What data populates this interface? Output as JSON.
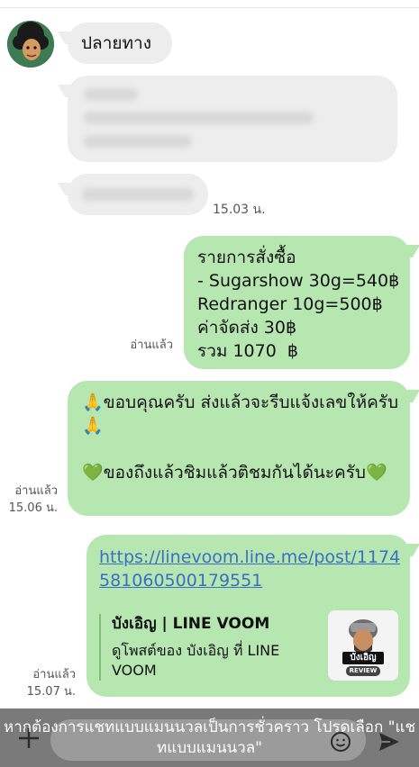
{
  "chat": {
    "sender_name": "ปลายทาง",
    "time_1": "15.03 น.",
    "order": {
      "lines": "รายการสั่งซื้อ\n- Sugarshow 30g=540฿\nRedranger 10g=500฿\nค่าจัดส่ง 30฿\nรวม 1070  ฿",
      "read": "อ่านแล้ว"
    },
    "thanks": {
      "lines": "🙏ขอบคุณครับ ส่งแล้วจะรีบแจ้งเลขให้ครับ🙏\n\n💚ของถึงแล้วชิมแล้วติชมกันได้นะครับ💚",
      "read": "อ่านแล้ว",
      "time": "15.06 น."
    },
    "link_message": {
      "url": "https://linevoom.line.me/post/1174581060500179551",
      "preview_title": "บังเอิญ | LINE VOOM",
      "preview_desc": "ดูโพสต์ของ บังเอิญ ที่ LINE VOOM",
      "thumb_caption": "บังเอิญ",
      "thumb_badge": "REVIEW",
      "read": "อ่านแล้ว",
      "time": "15.07 น."
    }
  },
  "footer": {
    "notice": "หากต้องการแชทแบบแมนนวลเป็นการชั่วคราว โปรดเลือก \"แชทแบบแมนนวล\"",
    "plus_icon": "plus-icon",
    "emoji_icon": "emoji-icon",
    "send_icon": "send-icon"
  },
  "colors": {
    "sent_bubble": "#b6e7b0",
    "received_bubble": "#ededed",
    "link": "#3b6fc4",
    "footer_overlay": "#7a7a7a"
  }
}
